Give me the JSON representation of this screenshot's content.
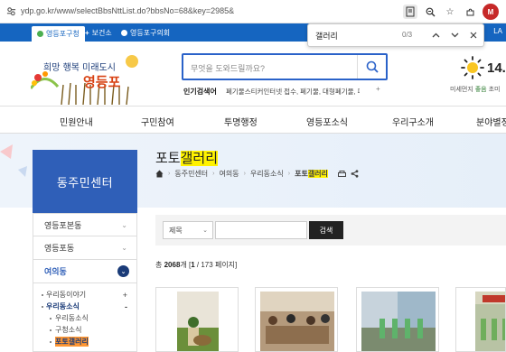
{
  "browser": {
    "url": "ydp.go.kr/www/selectBbsNttList.do?bbsNo=68&key=2985&",
    "find_query": "갤러리",
    "find_count": "0/3",
    "profile_initial": "M"
  },
  "topbar": {
    "tabs": [
      "영등포구청",
      "보건소",
      "영등포구의회"
    ],
    "right": "LA"
  },
  "logo": {
    "slogan": "희망 행복 미래도시",
    "name": "영등포"
  },
  "search": {
    "placeholder": "무엇을 도와드릴까요?",
    "popular_label": "인기검색어",
    "popular_keywords": "폐기물스티커인터넷 접수, 폐기물, 대형폐기물, 폐",
    "more": "+"
  },
  "weather": {
    "temp": "14.",
    "dust_label": "미세먼지",
    "dust_value": "좋음",
    "ultra_label": "초미"
  },
  "gnb": [
    "민원안내",
    "구민참여",
    "투명행정",
    "영등포소식",
    "우리구소개",
    "분야별정"
  ],
  "lnb": {
    "title": "동주민센터",
    "items": [
      {
        "label": "영등포본동"
      },
      {
        "label": "영등포동"
      },
      {
        "label": "여의동"
      }
    ],
    "sub": [
      {
        "label": "우리동이야기",
        "mark": "+"
      },
      {
        "label": "우리동소식",
        "mark": "-"
      },
      {
        "label": "우리동소식"
      },
      {
        "label": "구청소식"
      },
      {
        "label": "포토갤러리"
      }
    ]
  },
  "page": {
    "title_prefix": "포토",
    "title_highlight": "갤러리",
    "breadcrumb": [
      "동주민센터",
      "여의동",
      "우리동소식"
    ],
    "breadcrumb_last_prefix": "포토",
    "breadcrumb_last_highlight": "갤러리"
  },
  "filter": {
    "select_value": "제목",
    "button": "검색"
  },
  "total": {
    "prefix": "총",
    "count": "2068",
    "unit": "개",
    "page": "1",
    "pages": "173",
    "page_suffix": "페이지"
  },
  "colors": {
    "brand_blue": "#1565c0",
    "lnb_blue": "#2f5fb8",
    "find_highlight": "#fff200"
  }
}
